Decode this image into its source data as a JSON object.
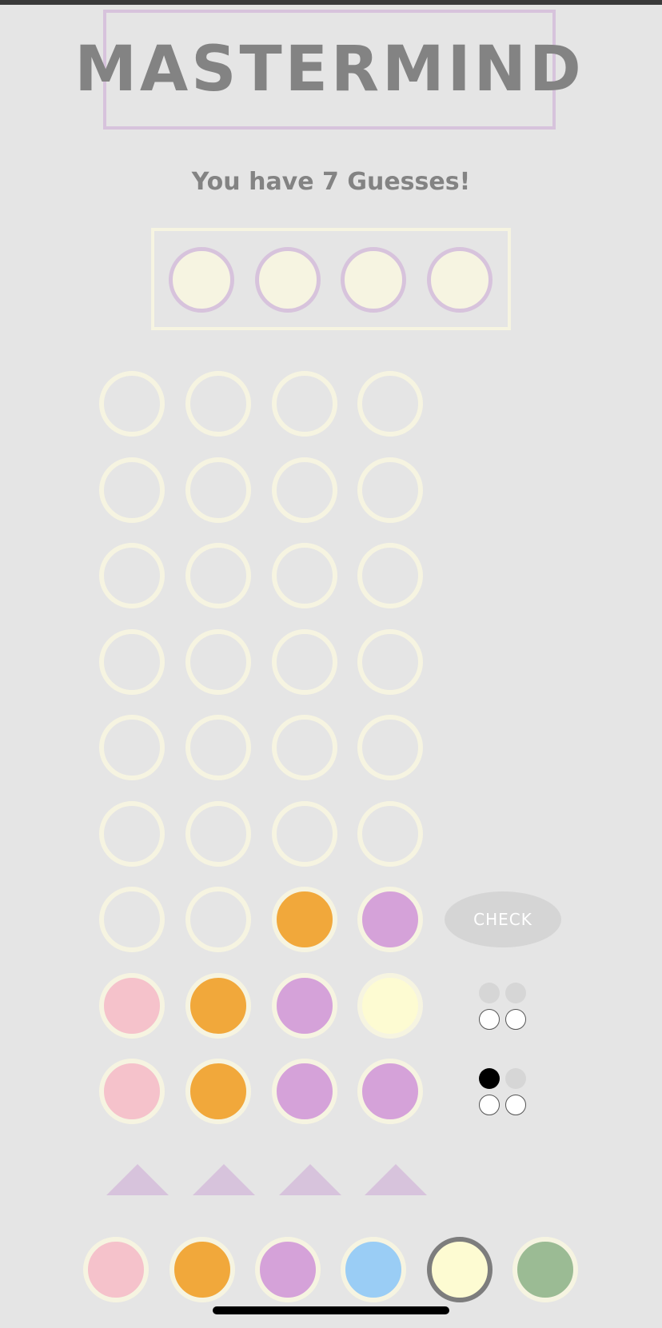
{
  "game": {
    "title": "MASTERMIND",
    "guesses_text": "You have 7 Guesses!"
  },
  "colors": {
    "pink": "#f5c2cb",
    "orange": "#f1a83b",
    "purple": "#d5a2d9",
    "blue": "#9acdf5",
    "cream": "#fdfbd2",
    "green": "#9bbb94",
    "empty_ring": "#f6f4e1",
    "accent_lilac": "#d7c3dc",
    "text_gray": "#838383"
  },
  "secret_code": [
    "hidden",
    "hidden",
    "hidden",
    "hidden"
  ],
  "board": {
    "rows": [
      {
        "pegs": [
          null,
          null,
          null,
          null
        ],
        "feedback": null
      },
      {
        "pegs": [
          null,
          null,
          null,
          null
        ],
        "feedback": null
      },
      {
        "pegs": [
          null,
          null,
          null,
          null
        ],
        "feedback": null
      },
      {
        "pegs": [
          null,
          null,
          null,
          null
        ],
        "feedback": null
      },
      {
        "pegs": [
          null,
          null,
          null,
          null
        ],
        "feedback": null
      },
      {
        "pegs": [
          null,
          null,
          null,
          null
        ],
        "feedback": null
      },
      {
        "pegs": [
          null,
          null,
          "orange",
          "purple"
        ],
        "feedback": null,
        "active": true
      },
      {
        "pegs": [
          "pink",
          "orange",
          "purple",
          "cream"
        ],
        "feedback": [
          "empty",
          "empty",
          "white",
          "white"
        ]
      },
      {
        "pegs": [
          "pink",
          "orange",
          "purple",
          "purple"
        ],
        "feedback": [
          "black",
          "empty",
          "white",
          "white"
        ]
      }
    ]
  },
  "controls": {
    "check_label": "CHECK"
  },
  "palette": {
    "selected": "cream",
    "items": [
      "pink",
      "orange",
      "purple",
      "blue",
      "cream",
      "green"
    ]
  }
}
